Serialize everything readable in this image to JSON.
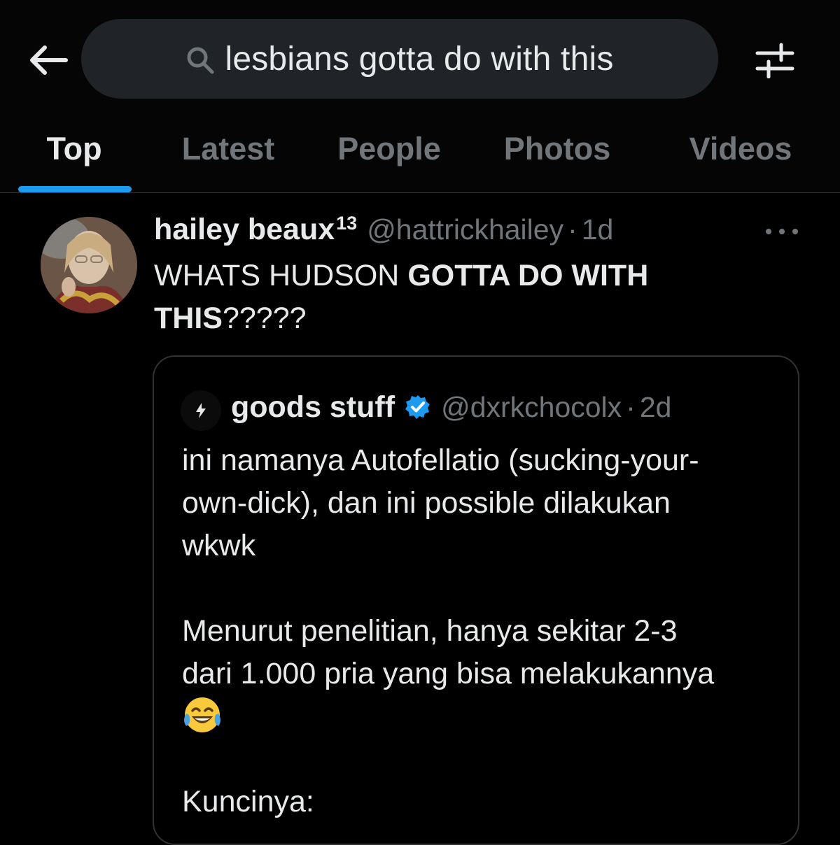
{
  "search": {
    "query": "lesbians gotta do with this",
    "back_icon": "arrow-left-icon",
    "search_icon": "magnifier-icon",
    "filter_icon": "sliders-icon"
  },
  "tabs": [
    {
      "label": "Top",
      "active": true
    },
    {
      "label": "Latest",
      "active": false
    },
    {
      "label": "People",
      "active": false
    },
    {
      "label": "Photos",
      "active": false
    },
    {
      "label": "Videos",
      "active": false
    }
  ],
  "tweet": {
    "author_name": "hailey beaux",
    "author_sup": "13",
    "handle": "@hattrickhailey",
    "separator": "·",
    "time": "1d",
    "text_part1": "WHATS HUDSON ",
    "text_bold1": "GOTTA DO WITH",
    "text_bold2": "THIS",
    "text_part2": "?????"
  },
  "quoted": {
    "author_name": "goods stuff",
    "verified": true,
    "handle": "@dxrkchocolx",
    "separator": "·",
    "time": "2d",
    "lines": [
      "ini namanya Autofellatio (sucking-your-",
      "own-dick), dan ini possible dilakukan",
      "wkwk",
      "",
      "Menurut penelitian, hanya sekitar 2-3",
      "dari 1.000 pria yang bisa melakukannya",
      "",
      "",
      "Kuncinya:"
    ],
    "emoji": "😂"
  },
  "colors": {
    "accent": "#1d9bf0",
    "text_primary": "#e7e9ea",
    "text_secondary": "#71767b",
    "search_bg": "#202327",
    "border": "#2f3336"
  }
}
